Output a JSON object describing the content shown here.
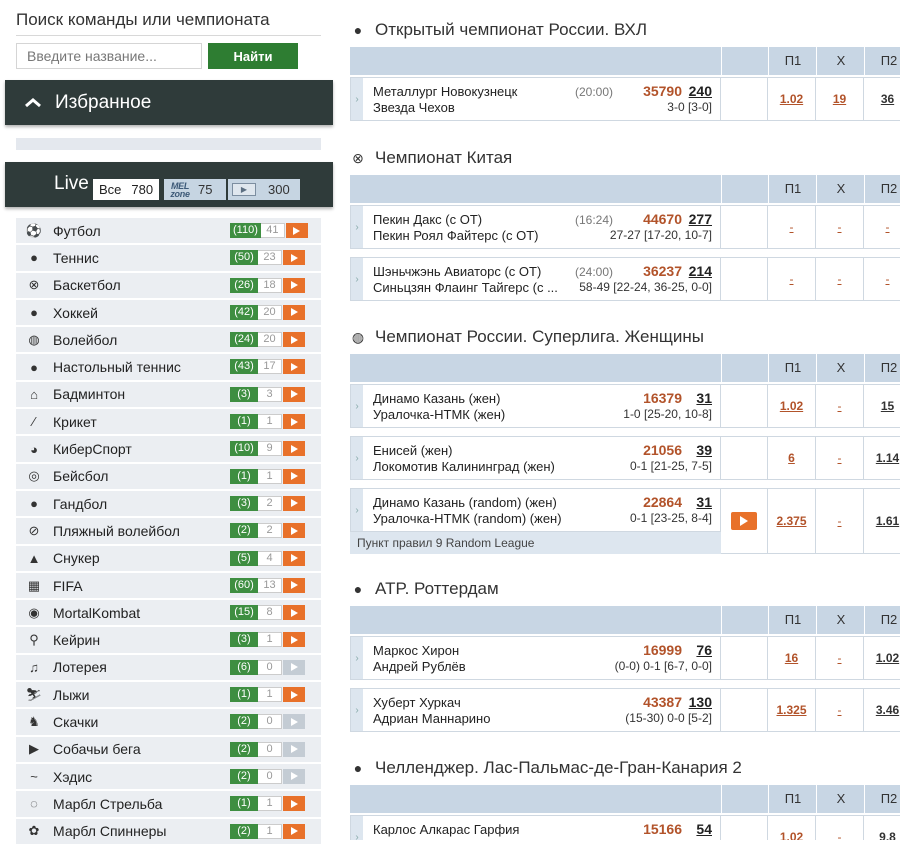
{
  "search": {
    "title": "Поиск команды или чемпионата",
    "placeholder": "Введите название...",
    "button": "Найти"
  },
  "favorites": {
    "label": "Избранное"
  },
  "live": {
    "label": "Live",
    "all_label": "Все",
    "all_count": "780",
    "mel_logo": "MEL zone",
    "mel_count": "75",
    "tv_count": "300"
  },
  "sports": [
    {
      "name": "Футбол",
      "icon": "soccer-ball-icon",
      "glyph": "⚽",
      "total": "(110)",
      "live": "41",
      "play": "orange"
    },
    {
      "name": "Теннис",
      "icon": "tennis-ball-icon",
      "glyph": "●",
      "total": "(50)",
      "live": "23",
      "play": "orange"
    },
    {
      "name": "Баскетбол",
      "icon": "basketball-icon",
      "glyph": "⊗",
      "total": "(26)",
      "live": "18",
      "play": "orange"
    },
    {
      "name": "Хоккей",
      "icon": "hockey-puck-icon",
      "glyph": "●",
      "total": "(42)",
      "live": "20",
      "play": "orange"
    },
    {
      "name": "Волейбол",
      "icon": "volleyball-icon",
      "glyph": "◍",
      "total": "(24)",
      "live": "20",
      "play": "orange"
    },
    {
      "name": "Настольный теннис",
      "icon": "ping-pong-icon",
      "glyph": "●",
      "total": "(43)",
      "live": "17",
      "play": "orange"
    },
    {
      "name": "Бадминтон",
      "icon": "shuttlecock-icon",
      "glyph": "⌂",
      "total": "(3)",
      "live": "3",
      "play": "orange"
    },
    {
      "name": "Крикет",
      "icon": "cricket-bat-icon",
      "glyph": "⁄",
      "total": "(1)",
      "live": "1",
      "play": "orange"
    },
    {
      "name": "КиберСпорт",
      "icon": "esports-icon",
      "glyph": "◕",
      "total": "(10)",
      "live": "9",
      "play": "orange"
    },
    {
      "name": "Бейсбол",
      "icon": "baseball-icon",
      "glyph": "◎",
      "total": "(1)",
      "live": "1",
      "play": "orange"
    },
    {
      "name": "Гандбол",
      "icon": "handball-icon",
      "glyph": "●",
      "total": "(3)",
      "live": "2",
      "play": "orange"
    },
    {
      "name": "Пляжный волейбол",
      "icon": "beach-volleyball-icon",
      "glyph": "⊘",
      "total": "(2)",
      "live": "2",
      "play": "orange"
    },
    {
      "name": "Снукер",
      "icon": "snooker-icon",
      "glyph": "▲",
      "total": "(5)",
      "live": "4",
      "play": "orange"
    },
    {
      "name": "FIFA",
      "icon": "fifa-icon",
      "glyph": "▦",
      "total": "(60)",
      "live": "13",
      "play": "orange"
    },
    {
      "name": "MortalKombat",
      "icon": "mortal-kombat-icon",
      "glyph": "◉",
      "total": "(15)",
      "live": "8",
      "play": "orange"
    },
    {
      "name": "Кейрин",
      "icon": "cycling-icon",
      "glyph": "⚲",
      "total": "(3)",
      "live": "1",
      "play": "orange"
    },
    {
      "name": "Лотерея",
      "icon": "lottery-icon",
      "glyph": "♫",
      "total": "(6)",
      "live": "0",
      "play": "grey"
    },
    {
      "name": "Лыжи",
      "icon": "skiing-icon",
      "glyph": "⛷",
      "total": "(1)",
      "live": "1",
      "play": "orange"
    },
    {
      "name": "Скачки",
      "icon": "horse-racing-icon",
      "glyph": "♞",
      "total": "(2)",
      "live": "0",
      "play": "grey"
    },
    {
      "name": "Собачьи бега",
      "icon": "dog-racing-icon",
      "glyph": "▶",
      "total": "(2)",
      "live": "0",
      "play": "grey"
    },
    {
      "name": "Хэдис",
      "icon": "hades-icon",
      "glyph": "~",
      "total": "(2)",
      "live": "0",
      "play": "grey"
    },
    {
      "name": "Марбл Стрельба",
      "icon": "marble-shooting-icon",
      "glyph": "◌",
      "total": "(1)",
      "live": "1",
      "play": "orange"
    },
    {
      "name": "Марбл Спиннеры",
      "icon": "marble-spinners-icon",
      "glyph": "✿",
      "total": "(2)",
      "live": "1",
      "play": "orange"
    }
  ],
  "columns": {
    "p1": "П1",
    "x": "Х",
    "p2": "П2"
  },
  "championships": [
    {
      "title": "Открытый чемпионат России. ВХЛ",
      "icon": "hockey-puck-icon",
      "glyph": "●",
      "matches": [
        {
          "team1": "Металлург Новокузнецк",
          "team2": "Звезда Чехов",
          "time": "(20:00)",
          "id": "35790",
          "count": "240",
          "score": "3-0 [3-0]",
          "p1": "1.02",
          "x": "19",
          "p2": "36",
          "video": false,
          "note": ""
        }
      ]
    },
    {
      "title": "Чемпионат Китая",
      "icon": "basketball-icon",
      "glyph": "⊗",
      "matches": [
        {
          "team1": "Пекин Дакс (с ОТ)",
          "team2": "Пекин Роял Файтерс (с ОТ)",
          "time": "(16:24)",
          "id": "44670",
          "count": "277",
          "score": "27-27 [17-20, 10-7]",
          "p1": "-",
          "x": "-",
          "p2": "-",
          "video": false,
          "note": ""
        },
        {
          "team1": "Шэньчжэнь Авиаторс (с ОТ)",
          "team2": "Синьцзян Флаинг Тайгерс (с ...",
          "time": "(24:00)",
          "id": "36237",
          "count": "214",
          "score": "58-49 [22-24, 36-25, 0-0]",
          "p1": "-",
          "x": "-",
          "p2": "-",
          "video": false,
          "note": ""
        }
      ]
    },
    {
      "title": "Чемпионат России. Суперлига. Женщины",
      "icon": "volleyball-icon",
      "glyph": "◍",
      "matches": [
        {
          "team1": "Динамо Казань (жен)",
          "team2": "Уралочка-НТМК (жен)",
          "time": "",
          "id": "16379",
          "count": "31",
          "score": "1-0 [25-20, 10-8]",
          "p1": "1.02",
          "x": "-",
          "p2": "15",
          "video": false,
          "note": ""
        },
        {
          "team1": "Енисей (жен)",
          "team2": "Локомотив Калининград (жен)",
          "time": "",
          "id": "21056",
          "count": "39",
          "score": "0-1 [21-25, 7-5]",
          "p1": "6",
          "x": "-",
          "p2": "1.14",
          "video": false,
          "note": ""
        },
        {
          "team1": "Динамо Казань (random) (жен)",
          "team2": "Уралочка-НТМК (random) (жен)",
          "time": "",
          "id": "22864",
          "count": "31",
          "score": "0-1 [23-25, 8-4]",
          "p1": "2.375",
          "x": "-",
          "p2": "1.61",
          "video": true,
          "note": "Пункт правил 9 Random League"
        }
      ]
    },
    {
      "title": "ATP. Роттердам",
      "icon": "tennis-ball-icon",
      "glyph": "●",
      "matches": [
        {
          "team1": "Маркос Хирон",
          "team2": "Андрей Рублёв",
          "time": "",
          "id": "16999",
          "count": "76",
          "score": "(0-0) 0-1 [6-7, 0-0]",
          "p1": "16",
          "x": "-",
          "p2": "1.02",
          "video": false,
          "note": ""
        },
        {
          "team1": "Хуберт Хуркач",
          "team2": "Адриан Маннарино",
          "time": "",
          "id": "43387",
          "count": "130",
          "score": "(15-30) 0-0 [5-2]",
          "p1": "1.325",
          "x": "-",
          "p2": "3.46",
          "video": false,
          "note": ""
        }
      ]
    },
    {
      "title": "Челленджер. Лас-Пальмас-де-Гран-Канария 2",
      "icon": "tennis-ball-icon",
      "glyph": "●",
      "matches": [
        {
          "team1": "Карлос Алкарас Гарфия",
          "team2": "",
          "time": "",
          "id": "15166",
          "count": "54",
          "score": "",
          "p1": "1.02",
          "x": "-",
          "p2": "9.8",
          "video": false,
          "note": ""
        }
      ]
    }
  ]
}
